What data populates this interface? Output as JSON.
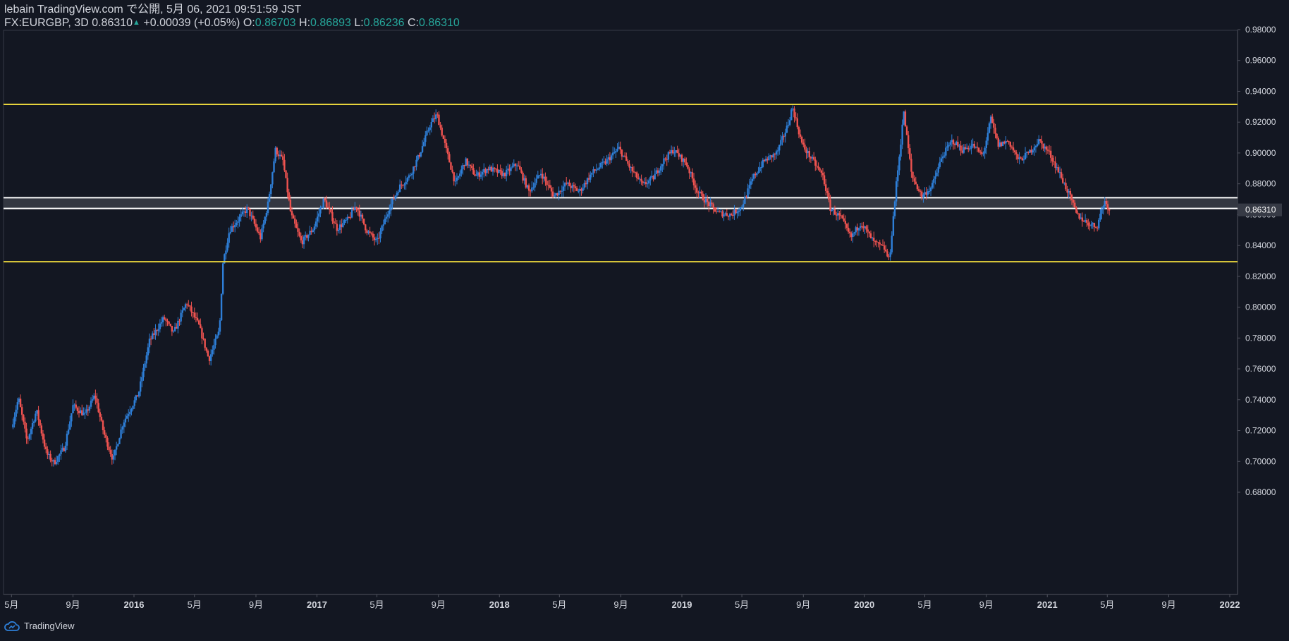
{
  "header": {
    "published_line": "lebain TradingView.com で公開, 5月 06, 2021 09:51:59 JST",
    "symbol": "FX:EURGBP, 3D",
    "last": "0.86310",
    "change_arrow": "▲",
    "change": "+0.00039 (+0.05%)",
    "o_label": "O:",
    "o_value": "0.86703",
    "h_label": "H:",
    "h_value": "0.86893",
    "l_label": "L:",
    "l_value": "0.86236",
    "c_label": "C:",
    "c_value": "0.86310"
  },
  "footer": {
    "brand": "TradingView"
  },
  "colors": {
    "background": "#131722",
    "up": "#2e7fd8",
    "down": "#ef5350",
    "support_resistance": "#e6d33c",
    "zone_border": "#ffffff",
    "zone_fill": "#3a3d46",
    "axis_text": "#d1d4dc",
    "price_label_bg": "#363a45"
  },
  "chart_data": {
    "type": "candlestick",
    "title": "",
    "ylim": [
      0.67,
      0.98
    ],
    "y_ticks": [
      "0.98000",
      "0.96000",
      "0.94000",
      "0.92000",
      "0.90000",
      "0.88000",
      "0.86000",
      "0.84000",
      "0.82000",
      "0.80000",
      "0.78000",
      "0.76000",
      "0.74000",
      "0.72000",
      "0.70000",
      "0.68000"
    ],
    "y_tick_values": [
      0.98,
      0.96,
      0.94,
      0.92,
      0.9,
      0.88,
      0.86,
      0.84,
      0.82,
      0.8,
      0.78,
      0.76,
      0.74,
      0.72,
      0.7,
      0.68
    ],
    "x_ticks": [
      "5月",
      "9月",
      "2016",
      "5月",
      "9月",
      "2017",
      "5月",
      "9月",
      "2018",
      "5月",
      "9月",
      "2019",
      "5月",
      "9月",
      "2020",
      "5月",
      "9月",
      "2021",
      "5月",
      "9月",
      "2022"
    ],
    "x_tick_dates": [
      "2015-05",
      "2015-09",
      "2016-01",
      "2016-05",
      "2016-09",
      "2017-01",
      "2017-05",
      "2017-09",
      "2018-01",
      "2018-05",
      "2018-09",
      "2019-01",
      "2019-05",
      "2019-09",
      "2020-01",
      "2020-05",
      "2020-09",
      "2021-01",
      "2021-05",
      "2021-09",
      "2022-01"
    ],
    "last_price_label": "0.86310",
    "horizontal_lines": [
      {
        "name": "resistance",
        "value": 0.9315
      },
      {
        "name": "support",
        "value": 0.8295
      }
    ],
    "zone": {
      "top": 0.871,
      "bottom": 0.864
    },
    "close_path": [
      [
        "2015-05-01",
        0.722
      ],
      [
        "2015-05-15",
        0.741
      ],
      [
        "2015-06-01",
        0.713
      ],
      [
        "2015-06-20",
        0.733
      ],
      [
        "2015-07-10",
        0.705
      ],
      [
        "2015-07-25",
        0.699
      ],
      [
        "2015-08-15",
        0.709
      ],
      [
        "2015-09-01",
        0.736
      ],
      [
        "2015-09-25",
        0.73
      ],
      [
        "2015-10-15",
        0.743
      ],
      [
        "2015-11-01",
        0.719
      ],
      [
        "2015-11-20",
        0.701
      ],
      [
        "2015-12-10",
        0.725
      ],
      [
        "2016-01-10",
        0.744
      ],
      [
        "2016-02-01",
        0.778
      ],
      [
        "2016-03-01",
        0.793
      ],
      [
        "2016-03-20",
        0.783
      ],
      [
        "2016-04-15",
        0.803
      ],
      [
        "2016-05-10",
        0.788
      ],
      [
        "2016-05-30",
        0.766
      ],
      [
        "2016-06-20",
        0.785
      ],
      [
        "2016-06-27",
        0.829
      ],
      [
        "2016-07-10",
        0.85
      ],
      [
        "2016-08-15",
        0.864
      ],
      [
        "2016-09-10",
        0.845
      ],
      [
        "2016-09-25",
        0.867
      ],
      [
        "2016-10-10",
        0.902
      ],
      [
        "2016-10-25",
        0.895
      ],
      [
        "2016-11-10",
        0.86
      ],
      [
        "2016-12-01",
        0.842
      ],
      [
        "2016-12-25",
        0.851
      ],
      [
        "2017-01-15",
        0.87
      ],
      [
        "2017-02-10",
        0.851
      ],
      [
        "2017-03-05",
        0.857
      ],
      [
        "2017-03-20",
        0.866
      ],
      [
        "2017-04-10",
        0.85
      ],
      [
        "2017-05-01",
        0.842
      ],
      [
        "2017-05-25",
        0.864
      ],
      [
        "2017-06-15",
        0.878
      ],
      [
        "2017-07-05",
        0.885
      ],
      [
        "2017-07-25",
        0.899
      ],
      [
        "2017-08-15",
        0.918
      ],
      [
        "2017-08-29",
        0.925
      ],
      [
        "2017-09-20",
        0.898
      ],
      [
        "2017-10-05",
        0.88
      ],
      [
        "2017-10-25",
        0.895
      ],
      [
        "2017-11-15",
        0.885
      ],
      [
        "2017-12-10",
        0.89
      ],
      [
        "2018-01-10",
        0.886
      ],
      [
        "2018-02-05",
        0.893
      ],
      [
        "2018-03-01",
        0.875
      ],
      [
        "2018-03-25",
        0.887
      ],
      [
        "2018-04-20",
        0.872
      ],
      [
        "2018-05-15",
        0.88
      ],
      [
        "2018-06-10",
        0.875
      ],
      [
        "2018-07-05",
        0.887
      ],
      [
        "2018-08-01",
        0.894
      ],
      [
        "2018-08-28",
        0.903
      ],
      [
        "2018-09-20",
        0.89
      ],
      [
        "2018-10-15",
        0.879
      ],
      [
        "2018-11-05",
        0.884
      ],
      [
        "2018-11-25",
        0.895
      ],
      [
        "2018-12-15",
        0.902
      ],
      [
        "2019-01-10",
        0.893
      ],
      [
        "2019-02-01",
        0.875
      ],
      [
        "2019-02-20",
        0.868
      ],
      [
        "2019-03-15",
        0.861
      ],
      [
        "2019-04-10",
        0.86
      ],
      [
        "2019-04-30",
        0.865
      ],
      [
        "2019-05-25",
        0.885
      ],
      [
        "2019-06-15",
        0.895
      ],
      [
        "2019-07-10",
        0.9
      ],
      [
        "2019-08-01",
        0.918
      ],
      [
        "2019-08-10",
        0.93
      ],
      [
        "2019-08-30",
        0.905
      ],
      [
        "2019-09-20",
        0.895
      ],
      [
        "2019-10-10",
        0.885
      ],
      [
        "2019-10-25",
        0.864
      ],
      [
        "2019-11-15",
        0.858
      ],
      [
        "2019-12-05",
        0.845
      ],
      [
        "2019-12-25",
        0.855
      ],
      [
        "2020-01-20",
        0.842
      ],
      [
        "2020-02-10",
        0.838
      ],
      [
        "2020-02-20",
        0.83
      ],
      [
        "2020-03-05",
        0.88
      ],
      [
        "2020-03-15",
        0.91
      ],
      [
        "2020-03-19",
        0.928
      ],
      [
        "2020-04-05",
        0.885
      ],
      [
        "2020-04-25",
        0.872
      ],
      [
        "2020-05-15",
        0.878
      ],
      [
        "2020-06-05",
        0.898
      ],
      [
        "2020-06-25",
        0.908
      ],
      [
        "2020-07-15",
        0.902
      ],
      [
        "2020-08-05",
        0.905
      ],
      [
        "2020-08-25",
        0.898
      ],
      [
        "2020-09-10",
        0.922
      ],
      [
        "2020-09-25",
        0.905
      ],
      [
        "2020-10-15",
        0.908
      ],
      [
        "2020-11-05",
        0.895
      ],
      [
        "2020-11-25",
        0.9
      ],
      [
        "2020-12-15",
        0.908
      ],
      [
        "2021-01-05",
        0.9
      ],
      [
        "2021-01-25",
        0.887
      ],
      [
        "2021-02-15",
        0.872
      ],
      [
        "2021-03-01",
        0.86
      ],
      [
        "2021-03-20",
        0.855
      ],
      [
        "2021-04-10",
        0.852
      ],
      [
        "2021-04-25",
        0.869
      ],
      [
        "2021-05-06",
        0.8631
      ]
    ]
  }
}
